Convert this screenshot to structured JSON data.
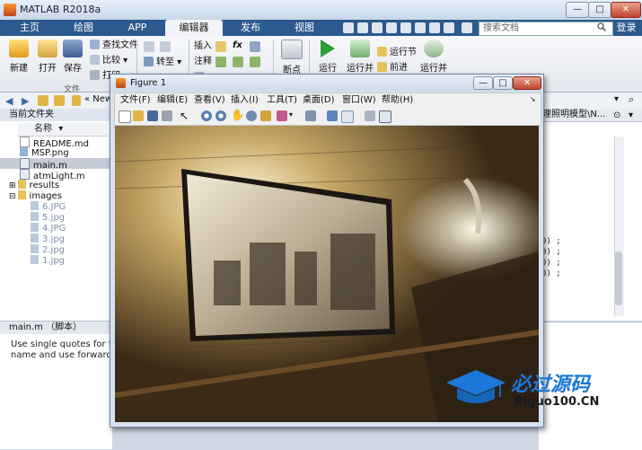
{
  "app": {
    "title": "MATLAB R2018a"
  },
  "window_buttons": {
    "minimize": "—",
    "maximize": "□",
    "close": "✕"
  },
  "tabs": [
    {
      "label": "主页"
    },
    {
      "label": "绘图"
    },
    {
      "label": "APP"
    },
    {
      "label": "编辑器"
    },
    {
      "label": "发布"
    },
    {
      "label": "视图"
    }
  ],
  "search": {
    "placeholder": "搜索文档"
  },
  "login": "登录",
  "ribbon": {
    "new": "新建",
    "open": "打开",
    "save": "保存",
    "find_files": "查找文件",
    "compare": "比较",
    "print": "打印",
    "file_group": "文件",
    "goto": "转至",
    "insert": "插入",
    "comment": "注释",
    "fx": "fx",
    "breakpoint": "断点",
    "run": "运行",
    "run_advance": "运行并",
    "run_section": "运行节",
    "advance": "前进",
    "run_time": "运行并"
  },
  "address": {
    "path": "« New"
  },
  "current_folder": {
    "header": "当前文件夹",
    "column_name": "名称",
    "sort_icon": "▾",
    "items": [
      {
        "name": "README.md",
        "type": "file"
      },
      {
        "name": "MSP.png",
        "type": "image"
      },
      {
        "name": "main.m",
        "type": "mfile",
        "selected": true
      },
      {
        "name": "atmLight.m",
        "type": "mfile"
      },
      {
        "name": "results",
        "type": "folder"
      },
      {
        "name": "images",
        "type": "folder"
      },
      {
        "name": "6.JPG",
        "type": "image"
      },
      {
        "name": "5.jpg",
        "type": "image"
      },
      {
        "name": "4.JPG",
        "type": "image"
      },
      {
        "name": "3.jpg",
        "type": "image"
      },
      {
        "name": "2.jpg",
        "type": "image"
      },
      {
        "name": "1.jpg",
        "type": "image"
      }
    ]
  },
  "details": {
    "header": "main.m （脚本）",
    "line1": "Use single quotes for the",
    "line2": "name and use forward sla"
  },
  "editor": {
    "tab_title": "理照明模型\\N...",
    "code_lines": [
      "0) ;",
      "0) ;",
      "0) ;",
      "0) ;"
    ]
  },
  "figure": {
    "title": "Figure 1",
    "menus": [
      "文件(F)",
      "编辑(E)",
      "查看(V)",
      "插入(I)",
      "工具(T)",
      "桌面(D)",
      "窗口(W)",
      "帮助(H)"
    ]
  },
  "watermark": {
    "text_cn": "必过源码",
    "text_en": "Biguo100.CN"
  }
}
